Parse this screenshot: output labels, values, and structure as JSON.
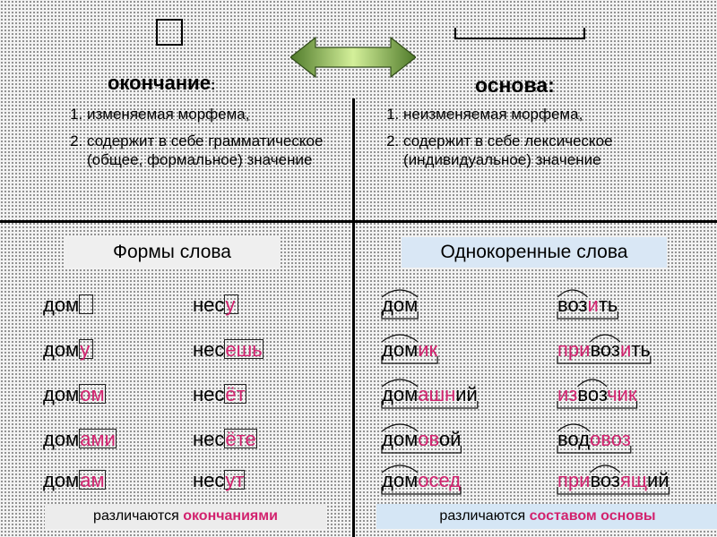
{
  "symbols": {
    "ending_icon": "ending-box-icon",
    "stem_icon": "stem-bracket-icon",
    "arrow_icon": "double-arrow-icon",
    "arrow_color": "#9bc45a"
  },
  "left": {
    "heading": "окончание",
    "heading_colon": ":",
    "properties": [
      "изменяемая морфема,",
      "содержит в себе грамматическое (общее, формальное) значение"
    ],
    "label": "Формы слова",
    "words_col1": [
      {
        "base": "дом",
        "ending": ""
      },
      {
        "base": "дом",
        "ending": "у"
      },
      {
        "base": "дом",
        "ending": "ом"
      },
      {
        "base": "дом",
        "ending": "ами"
      },
      {
        "base": "дом",
        "ending": "ам"
      }
    ],
    "words_col2": [
      {
        "base": "нес",
        "ending": "у"
      },
      {
        "base": "нес",
        "ending": "ешь"
      },
      {
        "base": "нес",
        "ending": "ёт"
      },
      {
        "base": "нес",
        "ending": "ёте"
      },
      {
        "base": "нес",
        "ending": "ут"
      }
    ],
    "summary_plain": "различаются ",
    "summary_bold": "окончаниями"
  },
  "right": {
    "heading": "основа:",
    "properties": [
      "неизменяемая морфема,",
      "содержит в себе лексическое (индивидуальное) значение"
    ],
    "label": "Однокоренные слова",
    "words_col1": [
      [
        {
          "t": "дом",
          "c": "black"
        }
      ],
      [
        {
          "t": "дом",
          "c": "black"
        },
        {
          "t": "ик",
          "c": "pink"
        }
      ],
      [
        {
          "t": "дом",
          "c": "black"
        },
        {
          "t": "ашн",
          "c": "pink"
        },
        {
          "t": "ий",
          "c": "black"
        }
      ],
      [
        {
          "t": "дом",
          "c": "black"
        },
        {
          "t": "ов",
          "c": "pink"
        },
        {
          "t": "ой",
          "c": "black"
        }
      ],
      [
        {
          "t": "дом",
          "c": "black"
        },
        {
          "t": "осед",
          "c": "pink"
        }
      ]
    ],
    "words_col2": [
      [
        {
          "t": "воз",
          "c": "black"
        },
        {
          "t": "и",
          "c": "pink"
        },
        {
          "t": "ть",
          "c": "black"
        }
      ],
      [
        {
          "t": "при",
          "c": "pink"
        },
        {
          "t": "воз",
          "c": "black"
        },
        {
          "t": "и",
          "c": "pink"
        },
        {
          "t": "ть",
          "c": "black"
        }
      ],
      [
        {
          "t": "из",
          "c": "pink"
        },
        {
          "t": "воз",
          "c": "black"
        },
        {
          "t": "чик",
          "c": "pink"
        }
      ],
      [
        {
          "t": "вод",
          "c": "black"
        },
        {
          "t": "о",
          "c": "pink"
        },
        {
          "t": "воз",
          "c": "pink"
        }
      ],
      [
        {
          "t": "при",
          "c": "pink"
        },
        {
          "t": "воз",
          "c": "black"
        },
        {
          "t": "ящ",
          "c": "pink"
        },
        {
          "t": "ий",
          "c": "black"
        }
      ]
    ],
    "summary_plain": "различаются ",
    "summary_bold": "составом основы"
  },
  "colors": {
    "accent_pink": "#d2226e",
    "forms_label_bg": "#efefef",
    "roots_label_bg": "#d9e7f5"
  }
}
